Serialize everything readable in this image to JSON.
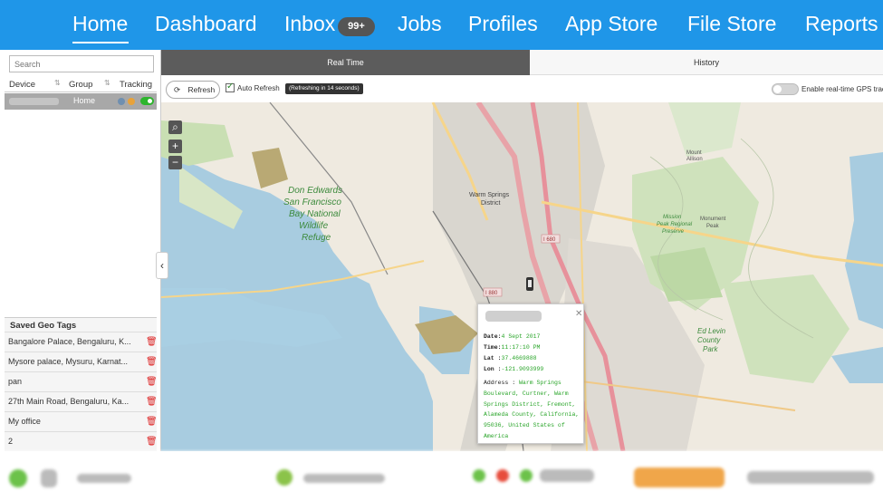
{
  "nav": {
    "items": [
      "Home",
      "Dashboard",
      "Inbox",
      "Jobs",
      "Profiles",
      "App Store",
      "File Store",
      "Reports"
    ],
    "inbox_badge": "99+",
    "active": "Home"
  },
  "sidebar": {
    "search_placeholder": "Search",
    "columns": [
      "Device",
      "Group",
      "Tracking"
    ],
    "device_row": {
      "group": "Home",
      "tracking": "on"
    },
    "saved_title": "Saved Geo Tags",
    "geo_tags": [
      "Bangalore Palace, Bengaluru, K...",
      "Mysore palace, Mysuru, Karnat...",
      "pan",
      "27th Main Road, Bengaluru, Ka...",
      "My office",
      "2"
    ]
  },
  "tabs": {
    "realtime": "Real Time",
    "history": "History"
  },
  "toolbar": {
    "refresh": "Refresh",
    "auto_refresh": "Auto Refresh",
    "refresh_status": "(Refreshing in 14 seconds)",
    "gps_label": "Enable real-time GPS trac"
  },
  "map_labels": {
    "refuge": "Don Edwards San Francisco Bay National Wildlife Refuge",
    "warm_springs": "Warm Springs District",
    "mission": "Mission Peak Regional Preserve",
    "monument": "Monument Peak",
    "mount": "Mount Allison",
    "ed_levin": "Ed Levin County Park",
    "i680": "I 680",
    "i880": "I 880"
  },
  "popup": {
    "date_label": "Date:",
    "date": "4 Sept 2017",
    "time_label": "Time:",
    "time": "11:17:10 PM",
    "lat_label": "Lat :",
    "lat": "37.4669888",
    "lon_label": "Lon :",
    "lon": "-121.9093999",
    "addr_label": "Address :",
    "addr": "Warm Springs Boulevard, Curtner, Warm Springs District, Fremont, Alameda County, California, 95036, United States of America"
  },
  "colors": {
    "nav_bg": "#1f96e8",
    "water": "#a8cce0",
    "land": "#f0ece3",
    "green": "#c9dfb3"
  }
}
